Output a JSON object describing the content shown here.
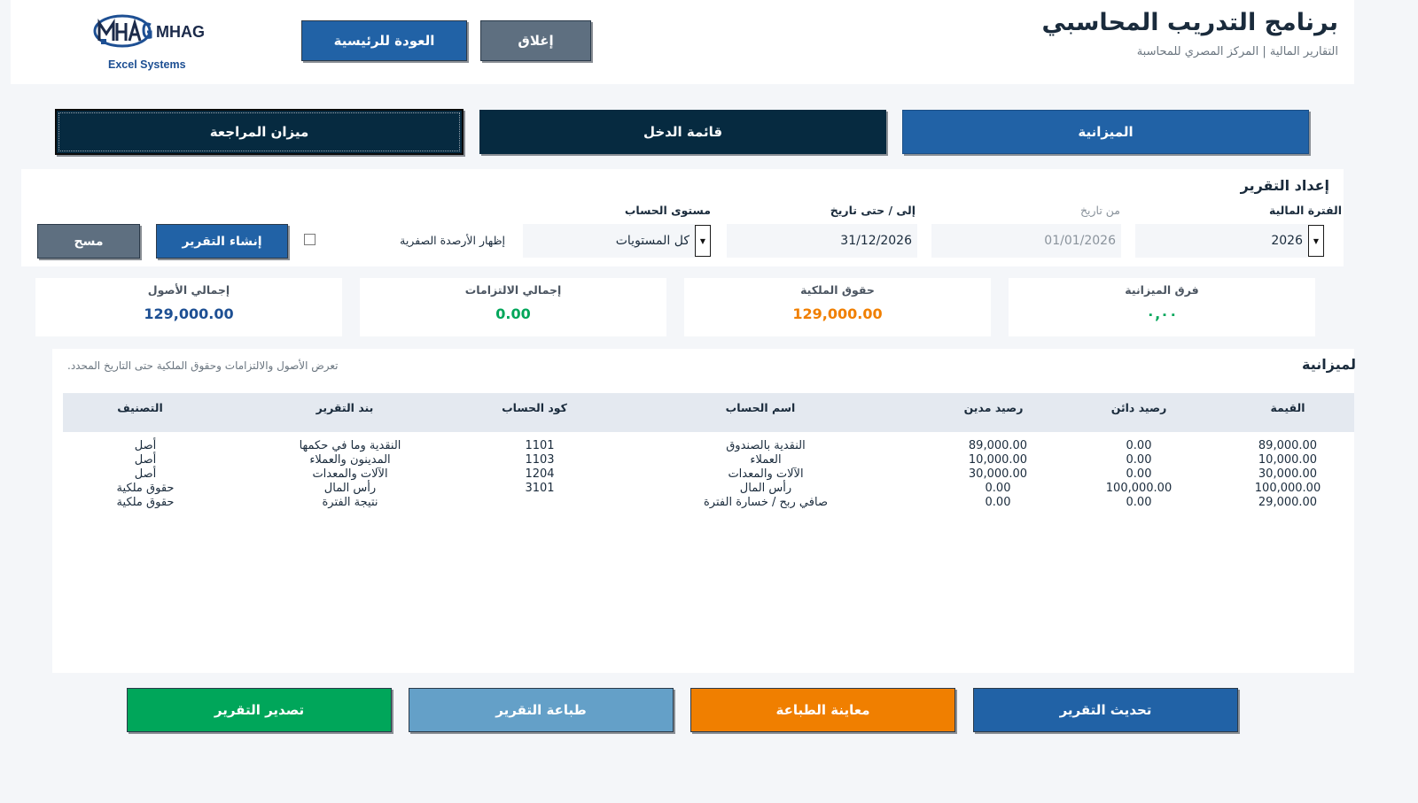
{
  "header": {
    "title": "برنامج التدريب المحاسبي",
    "subtitle": "التقارير المالية | المركز المصري للمحاسبة",
    "home_label": "العودة للرئيسية",
    "close_label": "إغلاق",
    "logo_name": "MHAG",
    "logo_sub": "Excel Systems"
  },
  "tabs": [
    {
      "label": "الميزانية"
    },
    {
      "label": "قائمة الدخل"
    },
    {
      "label": "ميزان المراجعة"
    }
  ],
  "setup": {
    "title": "إعداد التقرير",
    "fiscal_period_label": "الفترة المالية",
    "fiscal_period_value": "2026",
    "from_date_label": "من تاريخ",
    "from_date_value": "01/01/2026",
    "to_date_label": "إلى / حتى تاريخ",
    "to_date_value": "31/12/2026",
    "account_level_label": "مستوى الحساب",
    "account_level_value": "كل المستويات",
    "show_zero_label": "إظهار الأرصدة الصفرية",
    "show_zero_checked": false,
    "generate_label": "إنشاء التقرير",
    "clear_label": "مسح"
  },
  "summary": [
    {
      "label": "فرق الميزانية",
      "value": "٠,٠٠",
      "color": "#00a65a"
    },
    {
      "label": "حقوق الملكية",
      "value": "129,000.00",
      "color": "#f07f00"
    },
    {
      "label": "إجمالي الالتزامات",
      "value": "0.00",
      "color": "#00a65a"
    },
    {
      "label": "إجمالي الأصول",
      "value": "129,000.00",
      "color": "#1d4f93"
    }
  ],
  "report": {
    "title": "لميزانية",
    "description": "تعرض الأصول والالتزامات وحقوق الملكية حتى التاريخ المحدد.",
    "columns": [
      "القيمة",
      "رصيد دائن",
      "رصيد مدين",
      "اسم الحساب",
      "كود الحساب",
      "بند التقرير",
      "التصنيف"
    ],
    "rows": [
      {
        "value": "89,000.00",
        "credit": "0.00",
        "debit": "89,000.00",
        "account_name": "النقدية بالصندوق",
        "code": "1101",
        "item": "النقدية وما في حكمها",
        "category": "أصل"
      },
      {
        "value": "10,000.00",
        "credit": "0.00",
        "debit": "10,000.00",
        "account_name": "العملاء",
        "code": "1103",
        "item": "المدينون والعملاء",
        "category": "أصل"
      },
      {
        "value": "30,000.00",
        "credit": "0.00",
        "debit": "30,000.00",
        "account_name": "الآلات والمعدات",
        "code": "1204",
        "item": "الآلات والمعدات",
        "category": "أصل"
      },
      {
        "value": "100,000.00",
        "credit": "100,000.00",
        "debit": "0.00",
        "account_name": "رأس المال",
        "code": "3101",
        "item": "رأس المال",
        "category": "حقوق ملكية"
      },
      {
        "value": "29,000.00",
        "credit": "0.00",
        "debit": "0.00",
        "account_name": "صافي ربح / خسارة الفترة",
        "code": "",
        "item": "نتيجة الفترة",
        "category": "حقوق ملكية"
      }
    ]
  },
  "actions": {
    "refresh_label": "تحديث التقرير",
    "preview_label": "معاينة الطباعة",
    "print_label": "طباعة التقرير",
    "export_label": "تصدير التقرير"
  }
}
